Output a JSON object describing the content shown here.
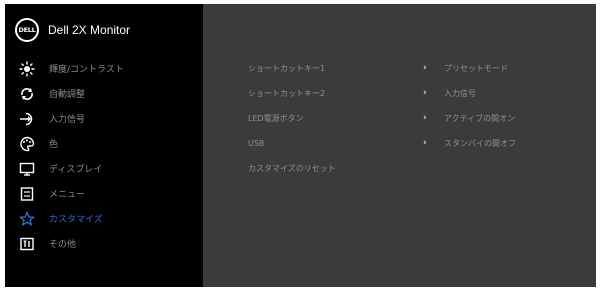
{
  "header": {
    "logo_text": "DELL",
    "model": "Dell 2X Monitor"
  },
  "menu": [
    {
      "label": "輝度/コントラスト",
      "icon": "brightness-icon",
      "active": false
    },
    {
      "label": "自動調整",
      "icon": "auto-adjust-icon",
      "active": false
    },
    {
      "label": "入力信号",
      "icon": "input-source-icon",
      "active": false
    },
    {
      "label": "色",
      "icon": "color-palette-icon",
      "active": false
    },
    {
      "label": "ディスプレイ",
      "icon": "display-icon",
      "active": false
    },
    {
      "label": "メニュー",
      "icon": "menu-icon",
      "active": false
    },
    {
      "label": "カスタマイズ",
      "icon": "star-icon",
      "active": true
    },
    {
      "label": "その他",
      "icon": "info-icon",
      "active": false
    }
  ],
  "settings": [
    {
      "label": "ショートカットキー1",
      "value": "プリセットモード"
    },
    {
      "label": "ショートカットキー2",
      "value": "入力信号"
    },
    {
      "label": "LED電源ボタン",
      "value": "アクティブの間オン"
    },
    {
      "label": "USB",
      "value": "スタンバイの間オフ"
    },
    {
      "label": "カスタマイズのリセット",
      "value": ""
    }
  ],
  "colors": {
    "active": "#2f6fd6",
    "sidebar_bg": "#000000",
    "panel_bg": "#3b3b3b",
    "icon": "#ffffff"
  }
}
